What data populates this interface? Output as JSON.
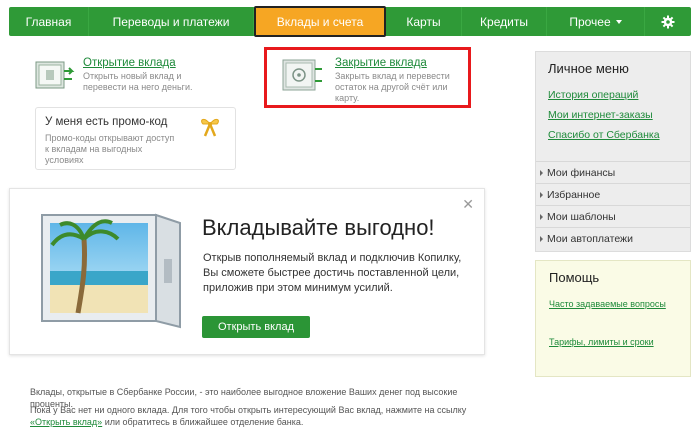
{
  "nav": {
    "items": [
      "Главная",
      "Переводы и платежи",
      "Вклады и счета",
      "Карты",
      "Кредиты",
      "Прочее"
    ],
    "active_index": 2,
    "settings_icon": "gear-icon"
  },
  "cards": {
    "open": {
      "title": "Открытие вклада",
      "desc": "Открыть новый вклад и перевести на него деньги.",
      "icon": "safe-open-icon"
    },
    "close": {
      "title": "Закрытие вклада",
      "desc": "Закрыть вклад и перевести остаток на другой счёт или карту.",
      "icon": "safe-close-icon"
    },
    "promo": {
      "title": "У меня есть промо-код",
      "desc": "Промо-коды открывают доступ к вкладам на выгодных условиях",
      "icon": "gift-bow-icon"
    }
  },
  "banner": {
    "title": "Вкладывайте выгодно!",
    "text": "Открыв пополняемый вклад и подключив Копилку, Вы сможете быстрее достичь поставленной цели, приложив при этом минимум усилий.",
    "button": "Открыть вклад",
    "close_symbol": "✕"
  },
  "footer": {
    "line1": "Вклады, открытые в Сбербанке России, - это наиболее выгодное вложение Ваших денег под высокие проценты.",
    "line2_start": "Пока у Вас нет ни одного вклада. Для того чтобы открыть интересующий Вас вклад, нажмите на ссылку ",
    "line2_link": "«Открыть вклад»",
    "line2_end": " или обратитесь в ближайшее отделение банка."
  },
  "sidebar": {
    "title": "Личное меню",
    "links": [
      "История операций",
      "Мои интернет-заказы",
      "Спасибо от Сбербанка"
    ],
    "menu": [
      "Мои финансы",
      "Избранное",
      "Мои шаблоны",
      "Мои автоплатежи"
    ]
  },
  "help": {
    "title": "Помощь",
    "links": [
      "Часто задаваемые вопросы",
      "Тарифы, лимиты и сроки"
    ]
  },
  "colors": {
    "brand_green": "#2f9a37",
    "active_tab": "#f6a623",
    "link_green": "#1e8a3a",
    "highlight_red": "#e8191c"
  }
}
